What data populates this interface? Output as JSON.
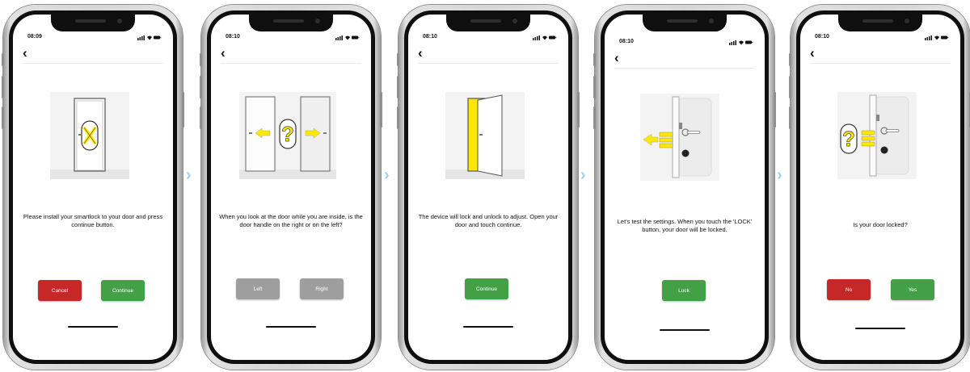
{
  "colors": {
    "accent_yellow": "#ffe800",
    "green": "#43a047",
    "red": "#c62828",
    "gray": "#9e9e9e",
    "arrow": "#9fd0ea"
  },
  "screens": [
    {
      "time": "08:09",
      "back_icon": "‹",
      "message": "Please install your smartlock to your door and press continue button.",
      "buttons": [
        "Cancel",
        "Continue"
      ],
      "illustration": "door-install-tools-icon"
    },
    {
      "time": "08:10",
      "back_icon": "‹",
      "message": "When you look at the door while you are inside, is the door handle on the right or on the left?",
      "buttons": [
        "Left",
        "Right"
      ],
      "illustration": "door-handle-side-question-icon"
    },
    {
      "time": "08:10",
      "back_icon": "‹",
      "message": "The device will lock and unlock to adjust. Open your door and touch continue.",
      "buttons": [
        "Continue"
      ],
      "illustration": "open-door-icon"
    },
    {
      "time": "08:10",
      "back_icon": "‹",
      "message": "Let's test the settings. When you touch the 'LOCK' button, your door will be locked.",
      "buttons": [
        "Lock"
      ],
      "illustration": "door-lock-bolt-icon"
    },
    {
      "time": "08:10",
      "back_icon": "‹",
      "message": "Is your door locked?",
      "buttons": [
        "No",
        "Yes"
      ],
      "illustration": "door-locked-question-icon"
    }
  ],
  "flow_arrow": "›"
}
